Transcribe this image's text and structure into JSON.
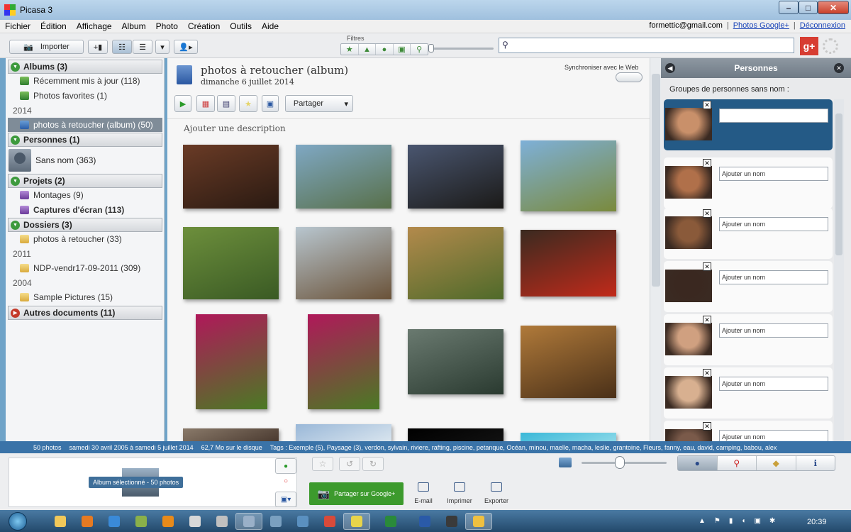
{
  "window": {
    "title": "Picasa 3",
    "minimize": "–",
    "maximize": "□",
    "close": "✕"
  },
  "menu": [
    "Fichier",
    "Édition",
    "Affichage",
    "Album",
    "Photo",
    "Création",
    "Outils",
    "Aide"
  ],
  "account": {
    "email": "formettic@gmail.com",
    "photos_link": "Photos Google+",
    "logout": "Déconnexion"
  },
  "toolbar": {
    "import_label": "Importer",
    "filters_label": "Filtres",
    "search_placeholder": "",
    "gplus_label": "g+"
  },
  "sidebar": {
    "albums_header": "Albums (3)",
    "albums": [
      {
        "label": "Récemment mis à jour (118)"
      },
      {
        "label": "Photos favorites (1)"
      }
    ],
    "year_2014": "2014",
    "selected_album": "photos à retoucher (album) (50)",
    "people_header": "Personnes (1)",
    "person": "Sans nom (363)",
    "projects_header": "Projets (2)",
    "projects": [
      {
        "label": "Montages (9)"
      },
      {
        "label": "Captures d'écran (113)"
      }
    ],
    "folders_header": "Dossiers (3)",
    "folder_1": "photos à retoucher (33)",
    "year_2011": "2011",
    "folder_2": "NDP-vendr17-09-2011 (309)",
    "year_2004": "2004",
    "folder_3": "Sample Pictures (15)",
    "other_header": "Autres documents (11)"
  },
  "main": {
    "album_title": "photos à retoucher (album)",
    "album_date": "dimanche 6 juillet 2014",
    "sync_label": "Synchroniser avec le Web",
    "share_label": "Partager",
    "add_description": "Ajouter une description",
    "photos": [
      {
        "name": "photo-man-face",
        "colors": [
          "#6a3b26",
          "#2a1a12"
        ]
      },
      {
        "name": "photo-river-canyon",
        "colors": [
          "#7fa8c4",
          "#58704a"
        ]
      },
      {
        "name": "photo-elephant-dusk",
        "colors": [
          "#4a5670",
          "#1b1a18"
        ]
      },
      {
        "name": "photo-kilimanjaro",
        "colors": [
          "#7eb0d8",
          "#7a8a3c"
        ]
      },
      {
        "name": "photo-zebra-field",
        "colors": [
          "#6d8f3c",
          "#3a5a24"
        ]
      },
      {
        "name": "photo-elephant-herd",
        "colors": [
          "#b8c6cf",
          "#6a5238"
        ]
      },
      {
        "name": "photo-cheetahs",
        "colors": [
          "#b38a4c",
          "#4f6a2a"
        ]
      },
      {
        "name": "photo-hands-rose",
        "colors": [
          "#3a2a20",
          "#c12a1a"
        ]
      },
      {
        "name": "photo-tulips-1",
        "colors": [
          "#b0185a",
          "#4a7a24"
        ]
      },
      {
        "name": "photo-tulips-2",
        "colors": [
          "#b0185a",
          "#4a7a24"
        ]
      },
      {
        "name": "photo-misty-lake",
        "colors": [
          "#6a7a70",
          "#2a3a30"
        ]
      },
      {
        "name": "photo-lion-reflection",
        "colors": [
          "#b07a3a",
          "#4a3018"
        ]
      },
      {
        "name": "photo-partial-1",
        "colors": [
          "#8a7a6a",
          "#4a3a30"
        ]
      },
      {
        "name": "photo-partial-2",
        "colors": [
          "#9ab8d8",
          "#d8e4ee"
        ]
      },
      {
        "name": "photo-partial-3",
        "colors": [
          "#000000",
          "#111111"
        ]
      },
      {
        "name": "photo-partial-4",
        "colors": [
          "#3ab8d8",
          "#8ad8e8"
        ]
      }
    ]
  },
  "people_panel": {
    "title": "Personnes",
    "subtitle": "Groupes de personnes sans nom :",
    "add_name_placeholder": "Ajouter un nom",
    "faces": [
      {
        "name": "face-1",
        "color": "#c9906a"
      },
      {
        "name": "face-2",
        "color": "#b0704a"
      },
      {
        "name": "face-3",
        "color": "#8a5a3a"
      },
      {
        "name": "face-4",
        "color": "#3a2820"
      },
      {
        "name": "face-5",
        "color": "#d0a080"
      },
      {
        "name": "face-6",
        "color": "#d8b090"
      },
      {
        "name": "face-7",
        "color": "#7a5a4a"
      }
    ]
  },
  "status": {
    "count": "50 photos",
    "range": "samedi 30 avril 2005 à samedi 5 juillet 2014",
    "size": "62,7 Mo sur le disque",
    "tags": "Tags : Exemple (5), Paysage (3), verdon, sylvain, riviere, rafting, piscine, petanque, Océan, minou, maelle, macha, leslie, grantoine, Fleurs, fanny, eau, david, camping, babou, alex"
  },
  "tray": {
    "badge": "Album sélectionné - 50 photos",
    "share_gplus": "Partager sur Google+",
    "email": "E-mail",
    "print": "Imprimer",
    "export": "Exporter"
  },
  "taskbar": {
    "time": "20:39"
  }
}
